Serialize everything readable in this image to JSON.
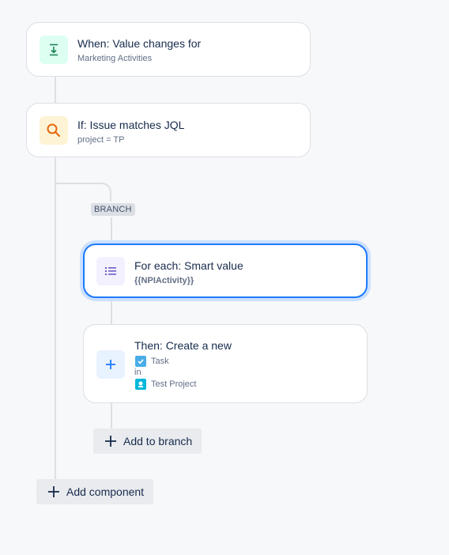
{
  "trigger": {
    "title": "When: Value changes for",
    "subtitle": "Marketing Activities",
    "icon": "download-icon",
    "color": "#1f845a"
  },
  "condition": {
    "title": "If: Issue matches JQL",
    "subtitle": "project = TP",
    "icon": "search-icon",
    "color": "#e56910"
  },
  "branch": {
    "label": "BRANCH",
    "for_each": {
      "title": "For each: Smart value",
      "subtitle": "{{NPIActivity}}",
      "icon": "list-icon",
      "color": "#6e5dc6"
    },
    "action": {
      "title": "Then: Create a new",
      "issue_type": "Task",
      "connector": "in",
      "project": "Test Project",
      "icon": "plus-icon",
      "color": "#1d7afc"
    },
    "add_label": "Add to branch"
  },
  "add_component_label": "Add component"
}
